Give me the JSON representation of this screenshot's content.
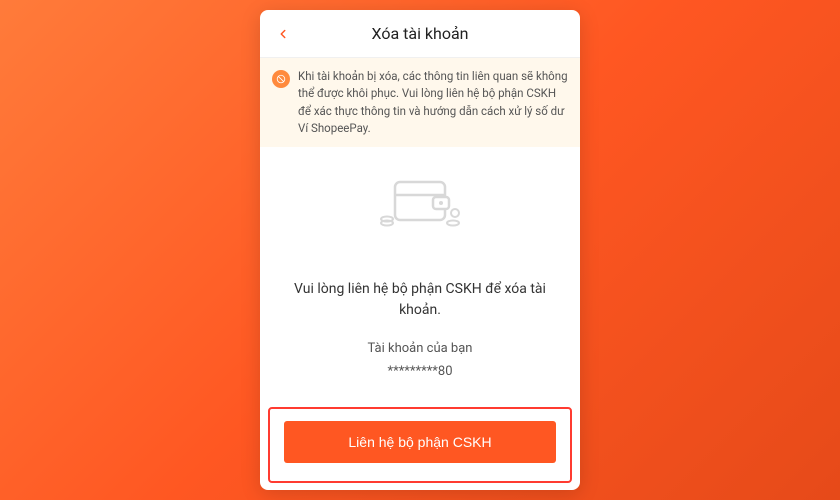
{
  "header": {
    "title": "Xóa tài khoản"
  },
  "warning": {
    "text": "Khi tài khoản bị xóa, các thông tin liên quan sẽ không thể được khôi phục. Vui lòng liên hệ bộ phận CSKH để xác thực thông tin và hướng dẫn cách xử lý số dư Ví ShopeePay."
  },
  "content": {
    "instruction": "Vui lòng liên hệ bộ phận CSKH để xóa tài khoản.",
    "account_label": "Tài khoản của bạn",
    "account_masked": "*********80"
  },
  "cta": {
    "label": "Liên hệ bộ phận CSKH"
  }
}
